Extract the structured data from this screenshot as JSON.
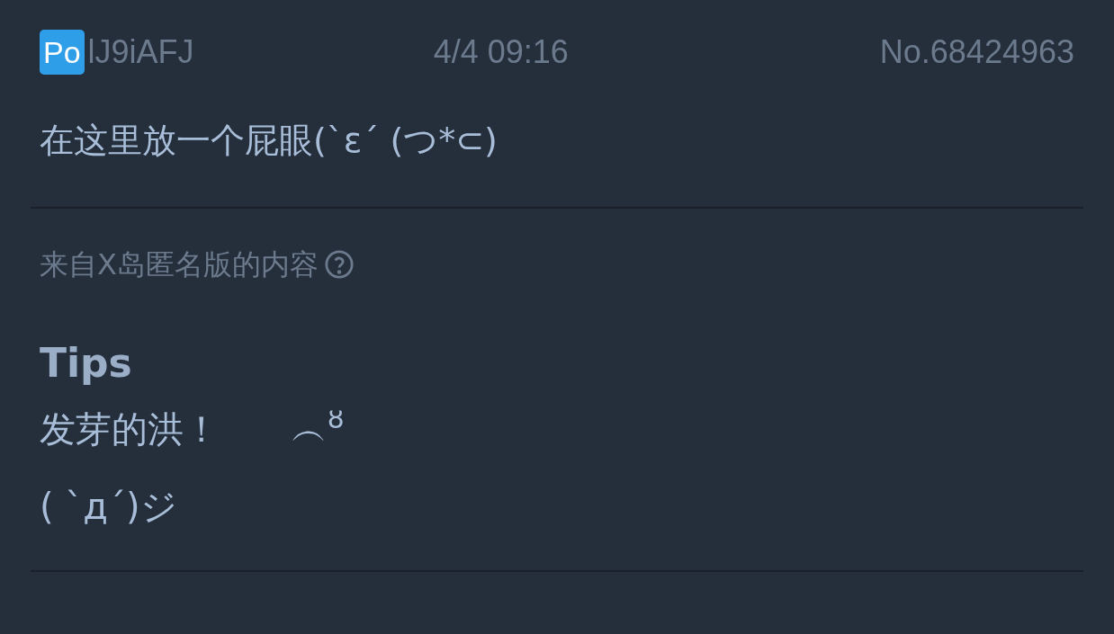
{
  "post": {
    "badge": "Po",
    "user_id": "lJ9iAFJ",
    "time": "4/4 09:16",
    "number": "No.68424963",
    "content": "在这里放一个屁眼(`ε´ (つ*⊂)"
  },
  "source": {
    "text": "来自X岛匿名版的内容"
  },
  "tips": {
    "title": "Tips",
    "lines": [
      "发芽的洪！　　︵$^{ȣ}$",
      "( `д´)ジ"
    ]
  }
}
